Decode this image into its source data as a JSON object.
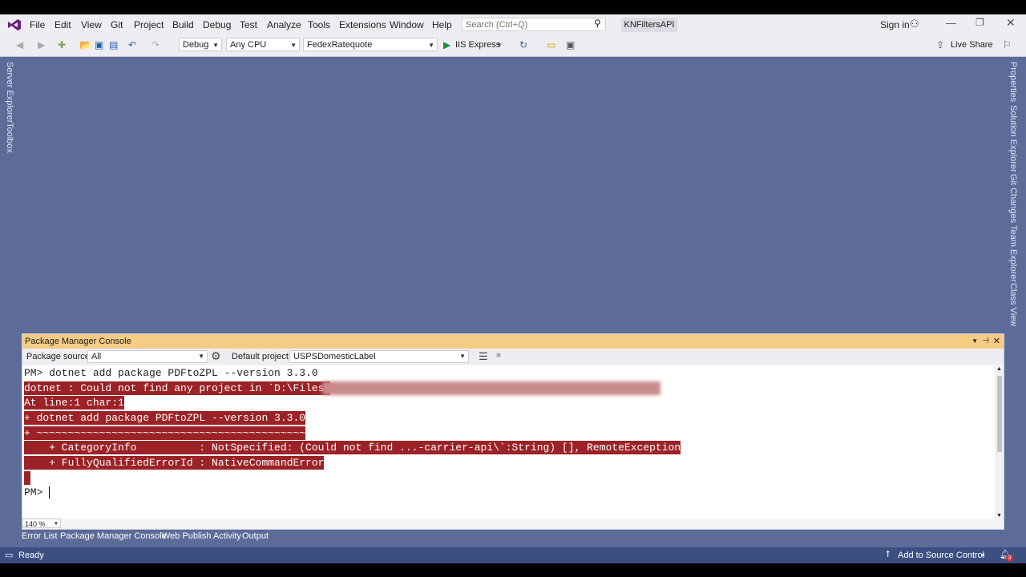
{
  "menu": [
    "File",
    "Edit",
    "View",
    "Git",
    "Project",
    "Build",
    "Debug",
    "Test",
    "Analyze",
    "Tools",
    "Extensions",
    "Window",
    "Help"
  ],
  "search_placeholder": "Search (Ctrl+Q)",
  "solution_name": "KNFiltersAPI",
  "sign_in": "Sign in",
  "toolbar": {
    "config": "Debug",
    "platform": "Any CPU",
    "startup_project": "FedexRatequote",
    "run_label": "IIS Express",
    "live_share": "Live Share"
  },
  "left_tabs": [
    "Server Explorer",
    "Toolbox"
  ],
  "right_tabs": [
    "Properties",
    "Solution Explorer",
    "Git Changes",
    "Team Explorer",
    "Class View"
  ],
  "pmc": {
    "title": "Package Manager Console",
    "package_source_label": "Package source:",
    "package_source": "All",
    "default_project_label": "Default project:",
    "default_project": "USPSDomesticLabel",
    "lines": [
      {
        "text": "PM> dotnet add package PDFtoZPL --version 3.3.0",
        "err": false
      },
      {
        "text": "dotnet : Could not find any project in `D:\\Files\\",
        "err": true
      },
      {
        "text": "At line:1 char:1",
        "err": true
      },
      {
        "text": "+ dotnet add package PDFtoZPL --version 3.3.0",
        "err": true
      },
      {
        "text": "+ ~~~~~~~~~~~~~~~~~~~~~~~~~~~~~~~~~~~~~~~~~~~",
        "err": true
      },
      {
        "text": "    + CategoryInfo          : NotSpecified: (Could not find ...-carrier-api\\`:String) [], RemoteException",
        "err": true
      },
      {
        "text": "    + FullyQualifiedErrorId : NativeCommandError",
        "err": true
      },
      {
        "text": " ",
        "err": true
      },
      {
        "text": "PM> ",
        "err": false
      }
    ],
    "zoom": "140 %"
  },
  "bottom_tabs": [
    "Error List",
    "Package Manager Console",
    "Web Publish Activity",
    "Output"
  ],
  "status": {
    "ready": "Ready",
    "source_control": "Add to Source Control",
    "notifications": "3"
  },
  "colors": {
    "accent": "#68217a",
    "main_bg": "#5d6b99",
    "error_bg": "#9b2226",
    "pmc_title": "#f5cc84"
  }
}
